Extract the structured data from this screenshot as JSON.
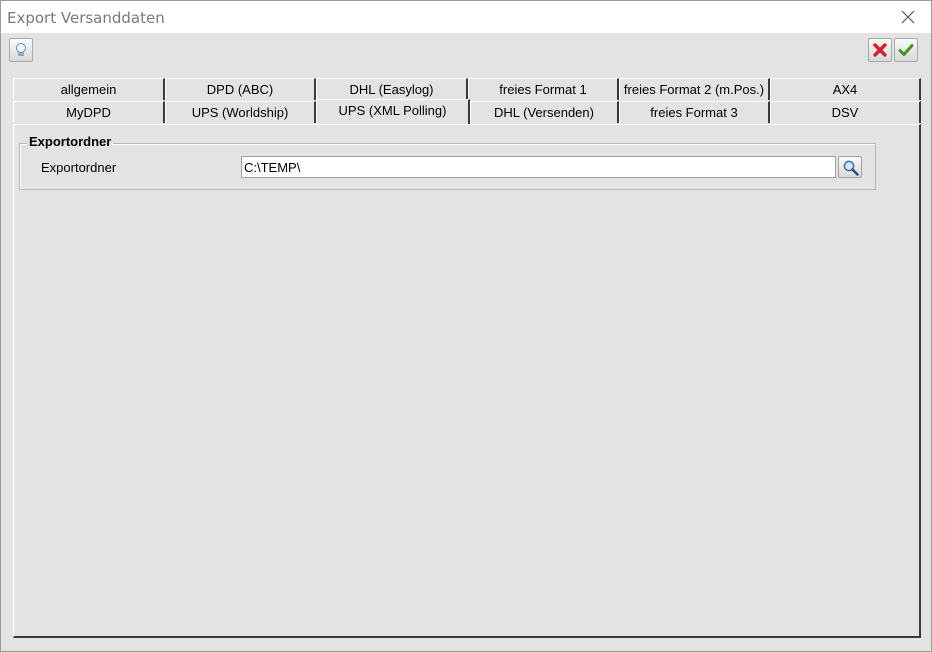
{
  "window": {
    "title": "Export Versanddaten"
  },
  "tabs": {
    "row1": [
      "allgemein",
      "DPD (ABC)",
      "DHL (Easylog)",
      "freies Format 1",
      "freies Format 2 (m.Pos.)",
      "AX4"
    ],
    "row2": [
      "MyDPD",
      "UPS (Worldship)",
      "UPS (XML Polling)",
      "DHL (Versenden)",
      "freies Format 3",
      "DSV"
    ],
    "active": "UPS (XML Polling)"
  },
  "panel": {
    "group_title": "Exportordner",
    "field_label": "Exportordner",
    "field_value": "C:\\TEMP\\"
  },
  "icons": {
    "toolbar_left": "lightbulb-icon",
    "cancel": "cancel-icon",
    "ok": "checkmark-icon",
    "browse": "magnifier-icon",
    "close": "close-icon"
  },
  "colors": {
    "cancel": "#d42020",
    "ok": "#3a9a1a"
  }
}
